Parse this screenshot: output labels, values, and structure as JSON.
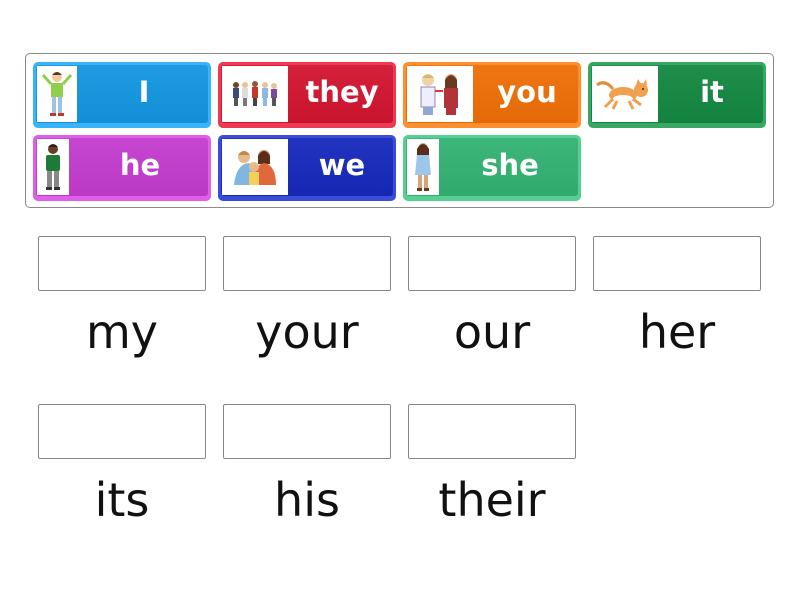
{
  "tiles": [
    {
      "label": "I",
      "color": "#1e9be3",
      "image": "boy-arms-raised",
      "row": 0,
      "col": 0
    },
    {
      "label": "they",
      "color": "#d42038",
      "image": "group-of-children",
      "row": 0,
      "col": 1
    },
    {
      "label": "you",
      "color": "#f07513",
      "image": "two-people-pointing",
      "row": 0,
      "col": 2
    },
    {
      "label": "it",
      "color": "#1f8e4a",
      "image": "cat-running",
      "row": 0,
      "col": 3
    },
    {
      "label": "he",
      "color": "#c645d1",
      "image": "boy-standing",
      "row": 1,
      "col": 0
    },
    {
      "label": "we",
      "color": "#2233c0",
      "image": "family-hug",
      "row": 1,
      "col": 1
    },
    {
      "label": "she",
      "color": "#3db679",
      "image": "girl-standing",
      "row": 1,
      "col": 2
    }
  ],
  "targets": [
    {
      "word": "my",
      "value": ""
    },
    {
      "word": "your",
      "value": ""
    },
    {
      "word": "our",
      "value": ""
    },
    {
      "word": "her",
      "value": ""
    },
    {
      "word": "its",
      "value": ""
    },
    {
      "word": "his",
      "value": ""
    },
    {
      "word": "their",
      "value": ""
    }
  ]
}
